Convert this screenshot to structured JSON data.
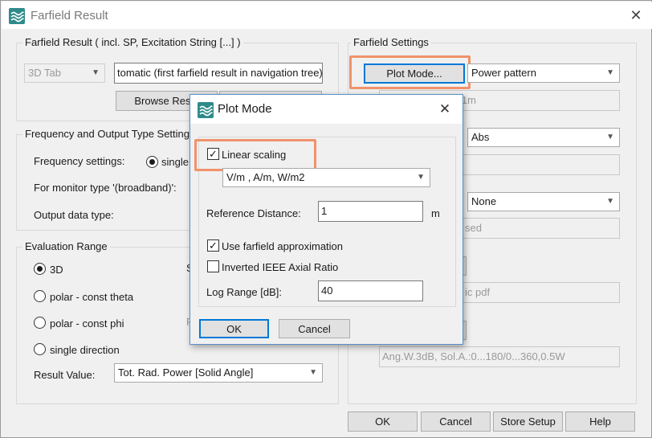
{
  "window": {
    "title": "Farfield Result",
    "close_icon": "close-icon"
  },
  "result_group": {
    "legend": "Farfield Result ( incl. SP, Excitation String [...] )",
    "tab_combo": "3D Tab",
    "result_field": "tomatic (first farfield result in navigation tree)",
    "browse_label": "Browse Resul"
  },
  "freq_group": {
    "legend": "Frequency and Output Type Setting",
    "freq_label": "Frequency settings:",
    "single_label": "single",
    "monitor_label": "For monitor type '(broadband)':",
    "output_label": "Output data type:"
  },
  "eval_group": {
    "legend": "Evaluation Range",
    "opt_3d": "3D",
    "opt_polar_theta": "polar - const theta",
    "opt_polar_phi": "polar - const phi",
    "opt_single_dir": "single direction",
    "partial_s": "S",
    "partial_f": "F",
    "result_value_label": "Result Value:",
    "result_value": "Tot. Rad. Power [Solid Angle]"
  },
  "settings_group": {
    "legend": "Farfield Settings",
    "plot_mode_button": "Plot Mode...",
    "plot_mode_combo": "Power pattern",
    "field1": "ist=1m",
    "combo2": "Abs",
    "combo3": "None",
    "field_sed": "sed",
    "field_pdf": "ic pdf",
    "field_ang": "Ang.W.3dB, Sol.A.:0...180/0...360,0.5W"
  },
  "bottom_buttons": {
    "ok": "OK",
    "cancel": "Cancel",
    "store": "Store Setup",
    "help": "Help"
  },
  "dialog": {
    "title": "Plot Mode",
    "linear_scaling": "Linear scaling",
    "units_combo": "V/m , A/m,  W/m2",
    "ref_distance_label": "Reference Distance:",
    "ref_distance_value": "1",
    "ref_distance_unit": "m",
    "use_farfield": "Use farfield approximation",
    "inverted_ieee": "Inverted IEEE Axial Ratio",
    "log_range_label": "Log Range [dB]:",
    "log_range_value": "40",
    "ok": "OK",
    "cancel": "Cancel"
  },
  "colors": {
    "accent": "#0078d7",
    "highlight": "#f0926a",
    "logo": "#2f8a8a"
  }
}
